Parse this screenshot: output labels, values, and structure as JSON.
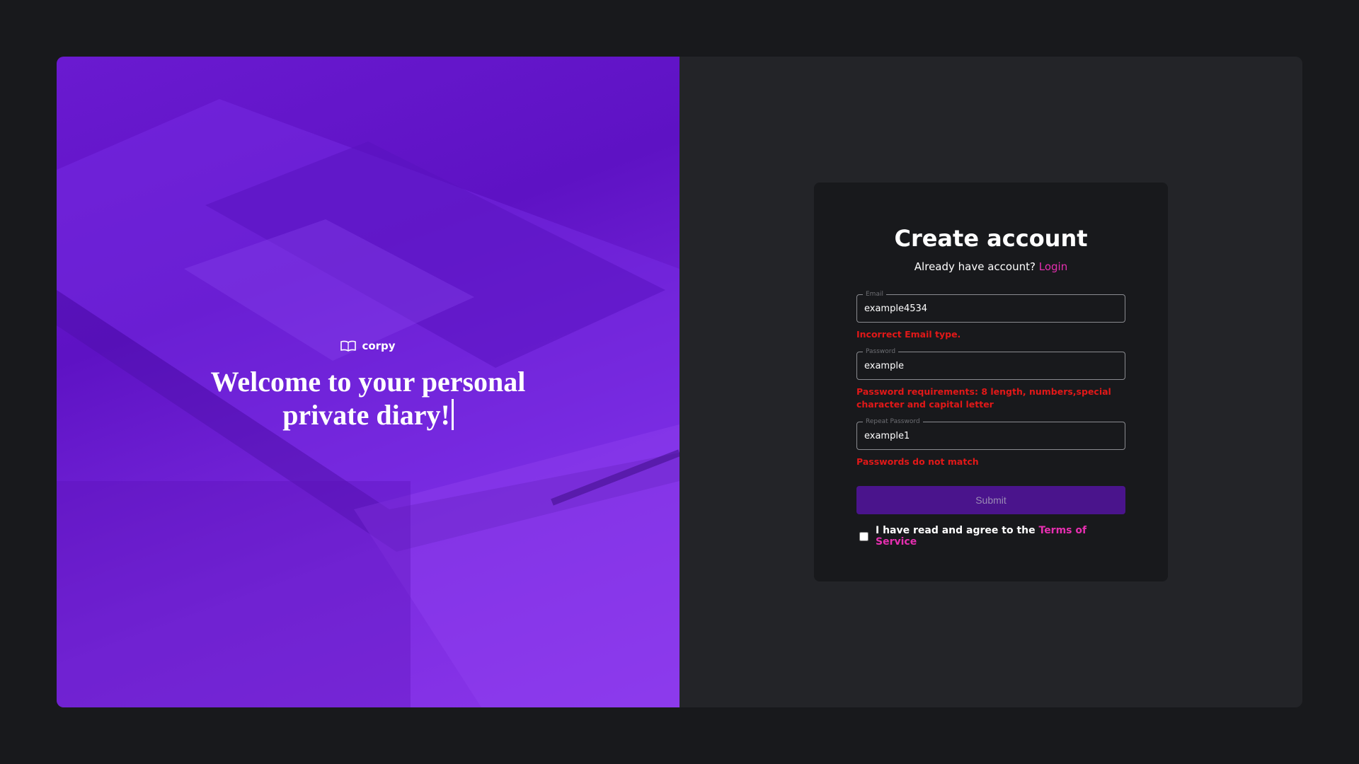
{
  "hero": {
    "brand_name": "corpy",
    "brand_icon": "open-book-icon",
    "title": "Welcome to your personal private diary!"
  },
  "form": {
    "title": "Create account",
    "subtitle_text": "Already have account?",
    "login_link": "Login",
    "email": {
      "label": "Email",
      "value": "example4534",
      "error": "Incorrect Email type."
    },
    "password": {
      "label": "Password",
      "value": "example",
      "error": "Password requirements: 8 length, numbers,special character and capital letter"
    },
    "repeat_password": {
      "label": "Repeat Password",
      "value": "example1",
      "error": "Passwords do not match"
    },
    "submit_label": "Submit",
    "terms_text": "I have read and agree to the",
    "terms_link": "Terms of Service",
    "terms_checked": false
  },
  "colors": {
    "page_bg": "#18191c",
    "panel_bg": "#232428",
    "card_bg": "#18191c",
    "hero_purple": "#6a1ad0",
    "accent_pink": "#e62fb0",
    "error_red": "#e11818",
    "submit_bg": "#4a148c"
  }
}
